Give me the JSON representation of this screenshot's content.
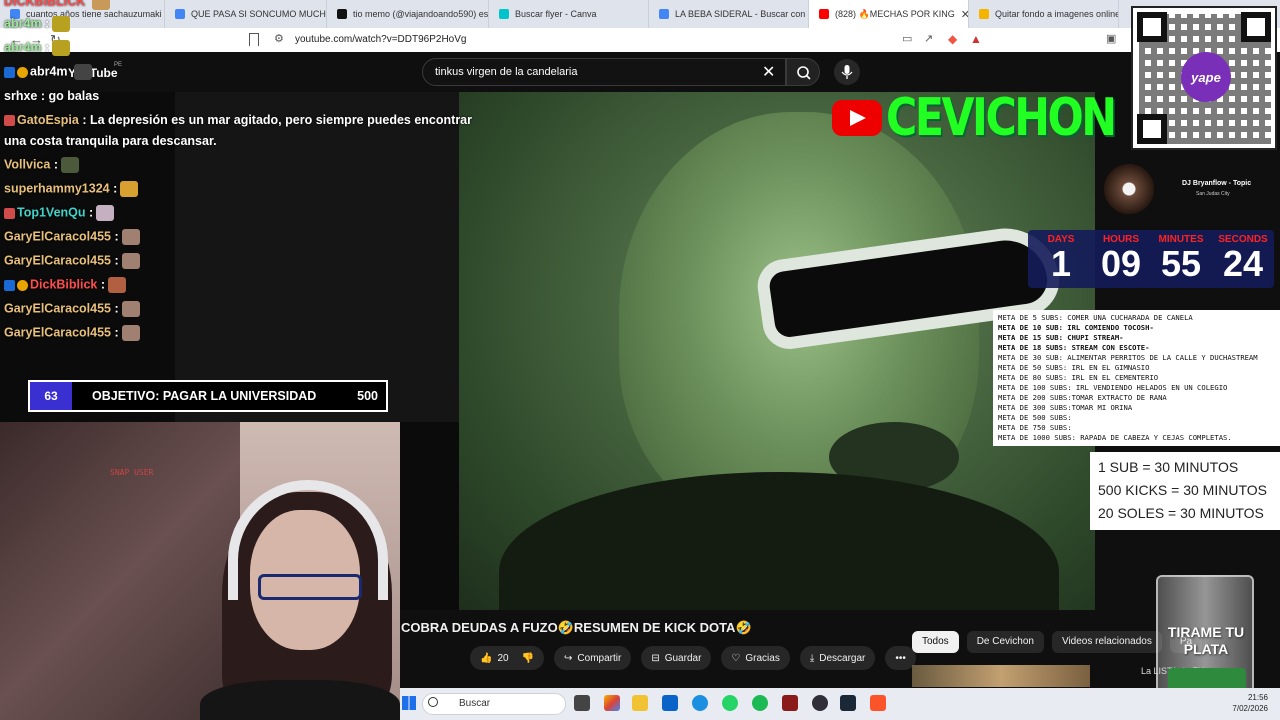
{
  "browser": {
    "tabs": [
      {
        "label": "cuantos años tiene sachauzumaki - B",
        "color": "#4285f4"
      },
      {
        "label": "QUE PASA SI SONCUMO MUCHA CA",
        "color": "#4285f4"
      },
      {
        "label": "tio memo (@viajandoando590) está",
        "color": "#111111"
      },
      {
        "label": "Buscar flyer - Canva",
        "color": "#00c4cc"
      },
      {
        "label": "LA BEBA SIDERAL - Buscar con Goog",
        "color": "#4285f4"
      },
      {
        "label": "(828) 🔥MECHAS POR KING",
        "color": "#ff0000",
        "active": true
      },
      {
        "label": "Quitar fondo a imagenes online y c",
        "color": "#f4b400"
      }
    ],
    "url": "youtube.com/watch?v=DDT96P2HoVg"
  },
  "youtube": {
    "logo": "YouTube",
    "region": "PE",
    "search_value": "tinkus virgen de la candelaria",
    "video_title": "COBRA DEUDAS A FUZO🤣RESUMEN DE KICK DOTA🤣",
    "actions": {
      "likes": "20",
      "share": "Compartir",
      "save": "Guardar",
      "thanks": "Gracias",
      "download": "Descargar",
      "more": "•••"
    },
    "chips": [
      "Todos",
      "De Cevichon",
      "Videos relacionados",
      "Pa"
    ],
    "reco_text": "La LISTA de FU..."
  },
  "chat": [
    {
      "user": "DICKBIBLICK",
      "text": "",
      "color": "#ff4d4d"
    },
    {
      "user": "abr4m",
      "text": ":",
      "color": "#9be89b"
    },
    {
      "user": "abr4m",
      "text": ":",
      "color": "#9be89b"
    },
    {
      "user": "abr4m",
      "text": "",
      "color": "#ffffff"
    },
    {
      "user": "srhxe",
      "text": ": go balas",
      "color": "#ffffff"
    },
    {
      "user": "GatoEspia",
      "text": ": La depresión es un mar agitado, pero siempre puedes encontrar",
      "color": "#e8c07a"
    },
    {
      "user": "",
      "text": "una costa tranquila para descansar.",
      "color": "#ffffff"
    },
    {
      "user": "Vollvica",
      "text": ":",
      "color": "#e8c07a"
    },
    {
      "user": "superhammy1324",
      "text": ":",
      "color": "#e8c07a"
    },
    {
      "user": "Top1VenQu",
      "text": ":",
      "color": "#3fd3c9"
    },
    {
      "user": "GaryElCaracol455",
      "text": ":",
      "color": "#e8c07a"
    },
    {
      "user": "GaryElCaracol455",
      "text": ":",
      "color": "#e8c07a"
    },
    {
      "user": "DickBiblick",
      "text": ":",
      "color": "#ff4d4d"
    },
    {
      "user": "GaryElCaracol455",
      "text": ":",
      "color": "#e8c07a"
    },
    {
      "user": "GaryElCaracol455",
      "text": ":",
      "color": "#e8c07a"
    }
  ],
  "goal": {
    "current": "63",
    "label": "OBJETIVO: PAGAR LA UNIVERSIDAD",
    "target": "500"
  },
  "webcam": {
    "snap_text": "SNAP USER"
  },
  "overlay": {
    "channel": "CEVICHON",
    "yape": "yape",
    "music_artist": "DJ Bryanflow - Topic",
    "music_album": "San Judas City",
    "countdown": [
      {
        "label": "DAYS",
        "value": "1"
      },
      {
        "label": "HOURS",
        "value": "09"
      },
      {
        "label": "MINUTES",
        "value": "55"
      },
      {
        "label": "SECONDS",
        "value": "24"
      }
    ],
    "metas": [
      {
        "text": "META DE 5 SUBS: COMER UNA CUCHARADA DE CANELA",
        "bold": false
      },
      {
        "text": "META DE 10 SUB: IRL COMIENDO TOCOSH-",
        "bold": true
      },
      {
        "text": "META DE 15 SUB: CHUPI STREAM-",
        "bold": true
      },
      {
        "text": "META DE 18 SUBS: STREAM CON ESCOTE-",
        "bold": true
      },
      {
        "text": "META DE 30 SUB:  ALIMENTAR PERRITOS DE LA CALLE Y DUCHASTREAM",
        "bold": false
      },
      {
        "text": "META DE 50 SUBS: IRL EN EL GIMNASIO",
        "bold": false
      },
      {
        "text": "META DE 80 SUBS: IRL EN EL CEMENTERIO",
        "bold": false
      },
      {
        "text": "META DE 100 SUBS: IRL VENDIENDO HELADOS EN UN COLEGIO",
        "bold": false
      },
      {
        "text": "META DE 200 SUBS:TOMAR EXTRACTO DE RANA",
        "bold": false
      },
      {
        "text": "META DE 300 SUBS:TOMAR MI ORINA",
        "bold": false
      },
      {
        "text": "META DE 500 SUBS:",
        "bold": false
      },
      {
        "text": "META DE 750 SUBS:",
        "bold": false
      },
      {
        "text": "META DE 1000 SUBS: RAPADA DE CABEZA Y CEJAS COMPLETAS.",
        "bold": false
      }
    ],
    "rates": [
      "1 SUB = 30 MINUTOS",
      "500 KICKS = 30 MINUTOS",
      "20 SOLES = 30 MINUTOS"
    ],
    "jar": "TIRAME TU PLATA"
  },
  "taskbar": {
    "search_placeholder": "Buscar",
    "time": "21:56",
    "date": "7/02/2026"
  }
}
